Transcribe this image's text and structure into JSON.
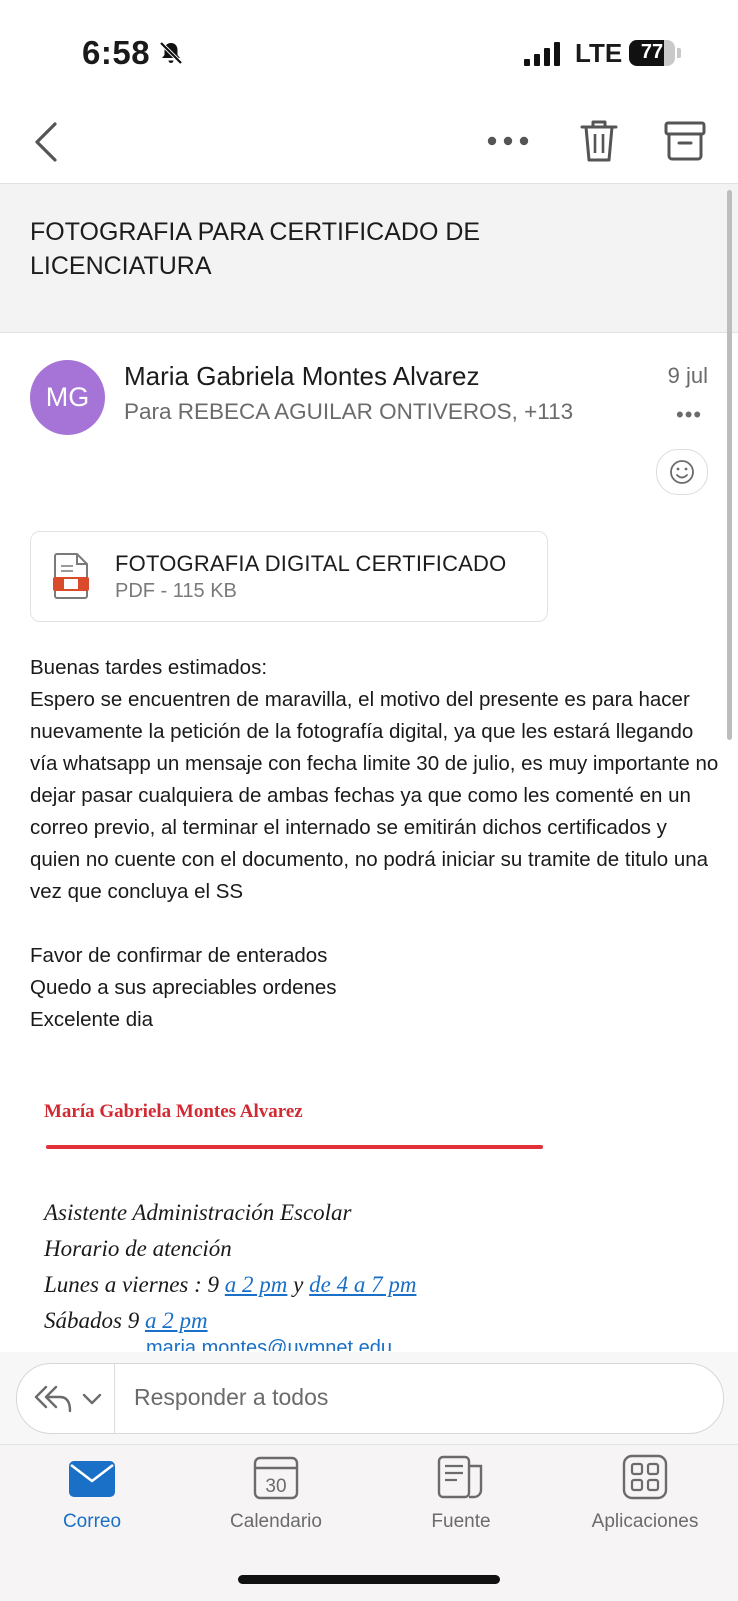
{
  "status_bar": {
    "time": "6:58",
    "network": "LTE",
    "battery": "77",
    "battery_level": 0.77
  },
  "toolbar": {
    "icons": [
      "back-icon",
      "more-icon",
      "trash-icon",
      "archive-icon"
    ]
  },
  "email": {
    "subject": "FOTOGRAFIA PARA CERTIFICADO DE LICENCIATURA",
    "sender_initials": "MG",
    "sender_name": "Maria Gabriela Montes Alvarez",
    "recipients": "Para REBECA AGUILAR ONTIVEROS, +113",
    "date": "9 jul",
    "more": "•••",
    "attachment": {
      "name": "FOTOGRAFIA DIGITAL CERTIFICADO",
      "meta": "PDF - 115 KB"
    },
    "body": {
      "greeting": "Buenas tardes estimados:",
      "paragraph": "Espero se encuentren de maravilla, el motivo del presente es para hacer nuevamente la petición de la fotografía digital, ya que les estará llegando vía whatsapp un mensaje con fecha limite 30 de julio, es muy importante no dejar pasar cualquiera de ambas fechas ya que como les comenté en un correo previo, al terminar el internado se emitirán dichos certificados y quien no cuente con el documento, no podrá iniciar su tramite de titulo una vez que concluya el SS",
      "line1": "Favor de confirmar de enterados",
      "line2": "Quedo a sus apreciables ordenes",
      "line3": "Excelente dia"
    },
    "signature": {
      "name": "María Gabriela Montes Alvarez",
      "role": "Asistente Administración Escolar",
      "hours_title": "Horario de atención",
      "weekday_prefix": "Lunes a viernes : 9 ",
      "weekday_link1": "a 2 pm",
      "weekday_mid": " y ",
      "weekday_link2": "de 4 a 7 pm",
      "saturday_prefix": "Sábados 9 ",
      "saturday_link": "a 2 pm",
      "email_partial": "maria.montes@uvmnet.edu"
    }
  },
  "reply": {
    "placeholder": "Responder a todos"
  },
  "tabs": [
    {
      "label": "Correo",
      "active": true
    },
    {
      "label": "Calendario",
      "calendar_day": "30"
    },
    {
      "label": "Fuente"
    },
    {
      "label": "Aplicaciones"
    }
  ],
  "colors": {
    "accent": "#1a6fc6",
    "avatar": "#a574d6",
    "signature_red": "#d12a33"
  }
}
